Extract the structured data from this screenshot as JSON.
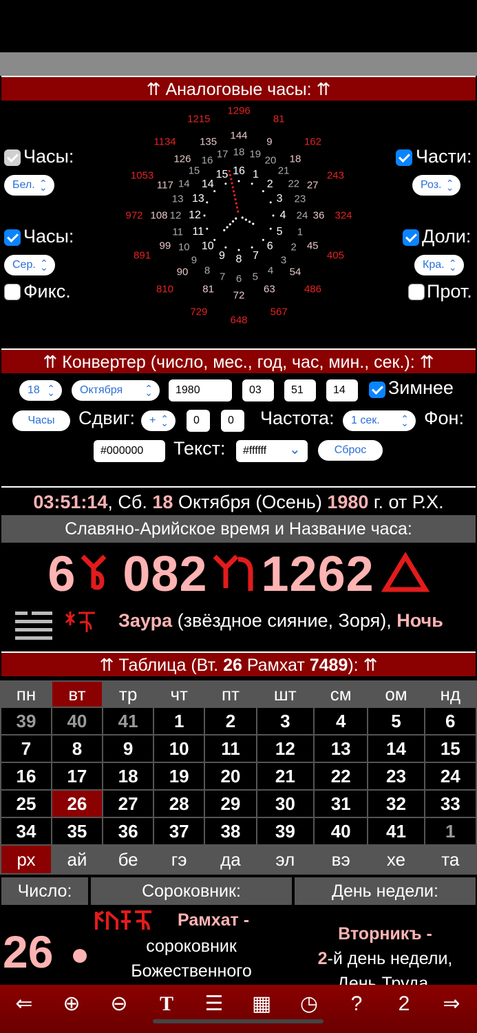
{
  "analog": {
    "header": "⇈ Аналоговые часы: ⇈",
    "left": {
      "hours1_label": "Часы:",
      "hours1_select": "Бел.",
      "hours2_label": "Часы:",
      "hours2_select": "Сер.",
      "fix_label": "Фикс."
    },
    "right": {
      "parts_label": "Части:",
      "parts_select": "Роз.",
      "shares_label": "Доли:",
      "shares_select": "Кра.",
      "prot_label": "Прот."
    },
    "clock": {
      "outer": [
        "1296",
        "81",
        "162",
        "243",
        "324",
        "405",
        "486",
        "567",
        "648",
        "729",
        "810",
        "891",
        "972",
        "1053",
        "1134",
        "1215"
      ],
      "middle": [
        "144",
        "9",
        "18",
        "27",
        "36",
        "45",
        "54",
        "63",
        "72",
        "81",
        "90",
        "99",
        "108",
        "117",
        "126",
        "135"
      ],
      "inner": [
        "18",
        "19",
        "20",
        "21",
        "22",
        "23",
        "24",
        "1",
        "2",
        "3",
        "4",
        "5",
        "6",
        "7",
        "8",
        "9",
        "10",
        "11",
        "12",
        "13",
        "14",
        "15",
        "16",
        "17"
      ],
      "hours": [
        "16",
        "1",
        "2",
        "3",
        "4",
        "5",
        "6",
        "7",
        "8",
        "9",
        "10",
        "11",
        "12",
        "13",
        "14",
        "15"
      ]
    }
  },
  "converter": {
    "header": "⇈ Конвертер (число, мес., год, час, мин., сек.): ⇈",
    "day": "18",
    "month": "Октября",
    "year": "1980",
    "hour": "03",
    "minute": "51",
    "second": "14",
    "winter_label": "Зимнее",
    "hours_button": "Часы",
    "shift_label": "Сдвиг:",
    "shift_sign": "+",
    "shift_a": "0",
    "shift_b": "0",
    "freq_label": "Частота:",
    "freq_value": "1 сек.",
    "bg_label": "Фон:",
    "bg_color": "#000000",
    "text_label": "Текст:",
    "text_color": "#ffffff",
    "reset_button": "Сброс"
  },
  "dateline": {
    "time": "03:51:14",
    "weekday": ", Сб. ",
    "day": "18",
    "month": " Октября (Осень) ",
    "year": "1980",
    "era": " г. от Р.Х."
  },
  "slavic": {
    "header": "Славяно-Арийское время и Название часа:",
    "h": "6",
    "mid": "082",
    "num": "1262",
    "hour_name_bold": "Заура",
    "hour_name_desc": " (звёздное сияние, Зоря), ",
    "hour_period": "Ночь"
  },
  "table": {
    "header_pre": "⇈ Таблица (Вт. ",
    "header_day": "26",
    "header_mid": " Рамхат ",
    "header_year": "7489",
    "header_post": "): ⇈",
    "weekdays": [
      "пн",
      "вт",
      "тр",
      "чт",
      "пт",
      "шт",
      "см",
      "ом",
      "нд"
    ],
    "rows": [
      [
        "39",
        "40",
        "41",
        "1",
        "2",
        "3",
        "4",
        "5",
        "6"
      ],
      [
        "7",
        "8",
        "9",
        "10",
        "11",
        "12",
        "13",
        "14",
        "15"
      ],
      [
        "16",
        "17",
        "18",
        "19",
        "20",
        "21",
        "22",
        "23",
        "24"
      ],
      [
        "25",
        "26",
        "27",
        "28",
        "29",
        "30",
        "31",
        "32",
        "33"
      ],
      [
        "34",
        "35",
        "36",
        "37",
        "38",
        "39",
        "40",
        "41",
        "1"
      ]
    ],
    "months": [
      "рх",
      "ай",
      "бе",
      "гэ",
      "да",
      "эл",
      "вэ",
      "хе",
      "та"
    ]
  },
  "info": {
    "number_head": "Число:",
    "sorok_head": "Сороковник:",
    "weekday_head": "День недели:",
    "number": "26",
    "sorok_name": "Рамхат -",
    "sorok_line1": "сороковник",
    "sorok_line2": "Божественного",
    "wd_name": "Вторникъ -",
    "wd_num": "2",
    "wd_line1": "-й день недели,",
    "wd_line2": "День Труда,"
  },
  "bottom": [
    "⇐",
    "⊕",
    "⊖",
    "T",
    "☰",
    "▦",
    "◷",
    "?",
    "2",
    "⇒"
  ]
}
